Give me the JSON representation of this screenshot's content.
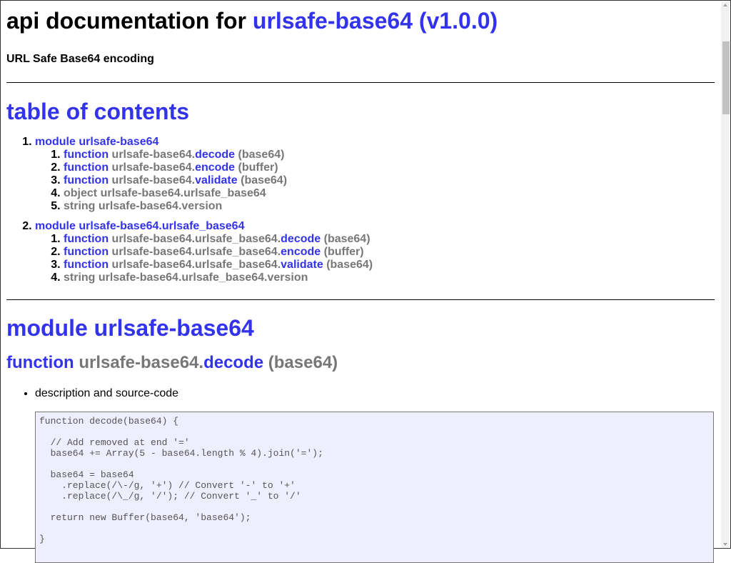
{
  "header": {
    "title_prefix": "api documentation for",
    "title_link": "urlsafe-base64 (v1.0.0)",
    "subtitle": "URL Safe Base64 encoding"
  },
  "toc": {
    "heading": "table of contents",
    "modules": [
      {
        "label": "module urlsafe-base64",
        "items": [
          {
            "kind": "function",
            "prefix": "urlsafe-base64.",
            "name": "decode",
            "args": "(base64)"
          },
          {
            "kind": "function",
            "prefix": "urlsafe-base64.",
            "name": "encode",
            "args": "(buffer)"
          },
          {
            "kind": "function",
            "prefix": "urlsafe-base64.",
            "name": "validate",
            "args": "(base64)"
          },
          {
            "kind": "object",
            "full": "object urlsafe-base64.urlsafe_base64"
          },
          {
            "kind": "string",
            "full": "string urlsafe-base64.version"
          }
        ]
      },
      {
        "label": "module urlsafe-base64.urlsafe_base64",
        "items": [
          {
            "kind": "function",
            "prefix": "urlsafe-base64.urlsafe_base64.",
            "name": "decode",
            "args": "(base64)"
          },
          {
            "kind": "function",
            "prefix": "urlsafe-base64.urlsafe_base64.",
            "name": "encode",
            "args": "(buffer)"
          },
          {
            "kind": "function",
            "prefix": "urlsafe-base64.urlsafe_base64.",
            "name": "validate",
            "args": "(base64)"
          },
          {
            "kind": "string",
            "full": "string urlsafe-base64.urlsafe_base64.version"
          }
        ]
      }
    ]
  },
  "main": {
    "module_heading": "module urlsafe-base64",
    "function_heading": {
      "kind": "function",
      "prefix": "urlsafe-base64.",
      "name": "decode",
      "args": "(base64)"
    },
    "desc_label": "description and source-code",
    "code": "function decode(base64) {\n\n  // Add removed at end '='\n  base64 += Array(5 - base64.length % 4).join('=');\n\n  base64 = base64\n    .replace(/\\-/g, '+') // Convert '-' to '+'\n    .replace(/\\_/g, '/'); // Convert '_' to '/'\n\n  return new Buffer(base64, 'base64');\n\n}"
  },
  "colors": {
    "link": "#3333ee",
    "muted": "#777777",
    "code_bg": "#eeeeff"
  }
}
